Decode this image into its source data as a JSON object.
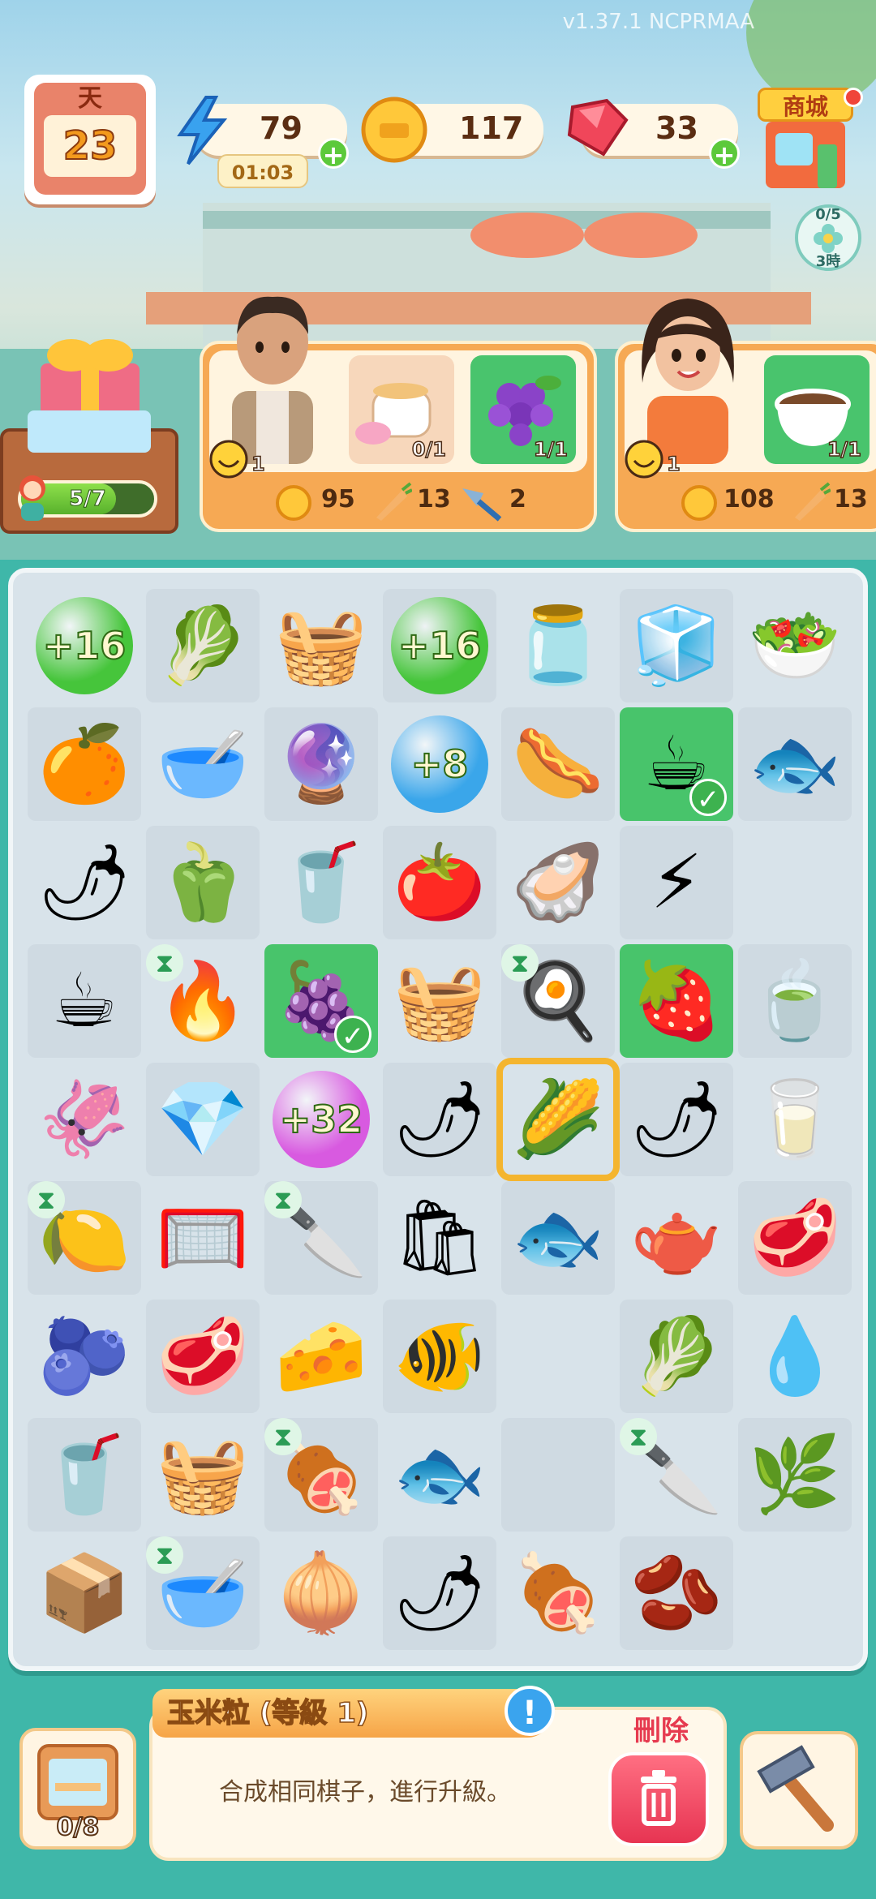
{
  "version": "v1.37.1 NCPRMAA",
  "calendar": {
    "label": "天",
    "day": "23"
  },
  "energy": {
    "value": "79",
    "timer": "01:03",
    "icon": "lightning-icon"
  },
  "coins": {
    "value": "117",
    "icon": "coin-icon"
  },
  "gems": {
    "value": "33",
    "icon": "ruby-icon"
  },
  "shop": {
    "label": "商城"
  },
  "flower_event": {
    "progress": "0/5",
    "time": "3時"
  },
  "gift_stand": {
    "progress": "5/7",
    "fraction": 0.714
  },
  "orders": [
    {
      "customer": "man-customer",
      "mood": "1",
      "items": [
        {
          "icon": "tea-set-icon",
          "count": "0/1",
          "done": false
        },
        {
          "icon": "grapes-icon",
          "count": "1/1",
          "done": true
        }
      ],
      "rewards": [
        {
          "icon": "coin-icon",
          "value": "95"
        },
        {
          "icon": "carrot-icon",
          "value": "13"
        },
        {
          "icon": "trowel-icon",
          "value": "2"
        }
      ]
    },
    {
      "customer": "woman-customer",
      "mood": "1",
      "items": [
        {
          "icon": "coffee-cup-icon",
          "count": "1/1",
          "done": true
        }
      ],
      "rewards": [
        {
          "icon": "coin-icon",
          "value": "108"
        },
        {
          "icon": "carrot-icon",
          "value": "13"
        }
      ]
    }
  ],
  "board": {
    "rows": [
      [
        {
          "name": "energy-bubble",
          "bubble": "+16",
          "color": "#46c53b"
        },
        {
          "name": "cabbage",
          "e": "🥬"
        },
        {
          "name": "veg-basket",
          "e": "🧺"
        },
        {
          "name": "energy-bubble",
          "bubble": "+16",
          "color": "#46c53b"
        },
        {
          "name": "chocolate-jar",
          "e": "🫙"
        },
        {
          "name": "ice-bin",
          "e": "🧊"
        },
        {
          "name": "salad-basket",
          "e": "🥗"
        }
      ],
      [
        {
          "name": "orange",
          "e": "🍊"
        },
        {
          "name": "peanut-butter-bowl",
          "e": "🥣"
        },
        {
          "name": "blue-generator",
          "e": "🔮"
        },
        {
          "name": "gem-bubble",
          "bubble": "+8",
          "color": "#3aa6ea"
        },
        {
          "name": "sausage",
          "e": "🌭"
        },
        {
          "name": "coffee-cup",
          "e": "☕",
          "green": true,
          "check": true
        },
        {
          "name": "red-fish",
          "e": "🐟"
        }
      ],
      [
        {
          "name": "chili-plate",
          "e": "🌶"
        },
        {
          "name": "bell-peppers",
          "e": "🫑"
        },
        {
          "name": "cup",
          "e": "🥤"
        },
        {
          "name": "tomato",
          "e": "🍅"
        },
        {
          "name": "mussel",
          "e": "🦪"
        },
        {
          "name": "energy-bolts",
          "e": "⚡"
        },
        {
          "name": "empty",
          "e": ""
        }
      ],
      [
        {
          "name": "coffee-machine",
          "e": "☕"
        },
        {
          "name": "grill",
          "e": "🔥",
          "hour": true
        },
        {
          "name": "grapes",
          "e": "🍇",
          "green": true,
          "check": true
        },
        {
          "name": "strawberry-basket",
          "e": "🧺"
        },
        {
          "name": "frying-pan",
          "e": "🍳",
          "hour": true
        },
        {
          "name": "strawberry",
          "e": "🍓",
          "green": true
        },
        {
          "name": "tea-bag",
          "e": "🍵"
        }
      ],
      [
        {
          "name": "squid",
          "e": "🦑"
        },
        {
          "name": "ruby",
          "e": "💎"
        },
        {
          "name": "purple-bubble",
          "bubble": "+32",
          "color": "#d85ae0"
        },
        {
          "name": "chili-plate",
          "e": "🌶"
        },
        {
          "name": "corn-kernels",
          "e": "🌽",
          "selected": true
        },
        {
          "name": "chili-plate",
          "e": "🌶"
        },
        {
          "name": "milk-bottle",
          "e": "🥛"
        }
      ],
      [
        {
          "name": "juicer",
          "e": "🍋",
          "hour": true
        },
        {
          "name": "blue-net",
          "e": "🥅"
        },
        {
          "name": "cutting-board",
          "e": "🔪",
          "hour": true
        },
        {
          "name": "grocery-bag",
          "e": "🛍"
        },
        {
          "name": "fish",
          "e": "🐟"
        },
        {
          "name": "tea-pot",
          "e": "🫖"
        },
        {
          "name": "meat-box",
          "e": "🥩"
        }
      ],
      [
        {
          "name": "blueberries",
          "e": "🫐"
        },
        {
          "name": "meat-crate",
          "e": "🥩"
        },
        {
          "name": "cheese",
          "e": "🧀"
        },
        {
          "name": "red-fish",
          "e": "🐠"
        },
        {
          "name": "empty",
          "e": ""
        },
        {
          "name": "cabbage",
          "e": "🥬"
        },
        {
          "name": "water-bottle",
          "e": "💧"
        }
      ],
      [
        {
          "name": "cup",
          "e": "🥤"
        },
        {
          "name": "fruit-basket",
          "e": "🧺"
        },
        {
          "name": "grill-stove",
          "e": "🍖",
          "hour": true
        },
        {
          "name": "bass-fish",
          "e": "🐟"
        },
        {
          "name": "empty",
          "e": ""
        },
        {
          "name": "prep-table",
          "e": "🔪",
          "hour": true
        },
        {
          "name": "scallions",
          "e": "🌿"
        }
      ],
      [
        {
          "name": "wooden-crate",
          "e": "📦"
        },
        {
          "name": "glass-bowl",
          "e": "🥣",
          "hour": true
        },
        {
          "name": "onion",
          "e": "🧅"
        },
        {
          "name": "chili-plate",
          "e": "🌶"
        },
        {
          "name": "ham",
          "e": "🍖"
        },
        {
          "name": "coffee-beans",
          "e": "🫘"
        },
        {
          "name": "empty",
          "e": ""
        }
      ]
    ]
  },
  "bottom": {
    "storage": "0/8",
    "item_title": "玉米粒 (等級 1)",
    "item_desc": "合成相同棋子，進行升級。",
    "delete_label": "刪除",
    "info_icon": "!"
  }
}
